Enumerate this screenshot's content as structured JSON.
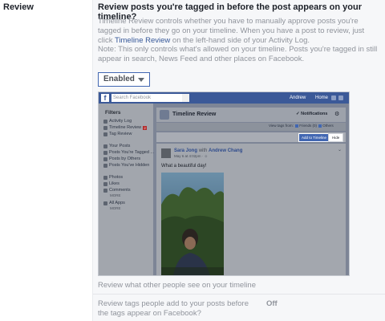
{
  "section": {
    "left_label": "Review",
    "heading": "Review posts you're tagged in before the post appears on your timeline?",
    "para1_a": "Timeline Review controls whether you have to manually approve posts you're tagged in before they go on your timeline. When you have a post to review, just click ",
    "para1_link": "Timeline Review",
    "para1_b": " on the left-hand side of your Activity Log.",
    "para2": "Note: This only controls what's allowed on your timeline. Posts you're tagged in still appear in search, News Feed and other places on Facebook.",
    "select_value": "Enabled"
  },
  "screenshot": {
    "fb_logo": "f",
    "search_placeholder": "Search Facebook",
    "user": "Andrew",
    "home": "Home",
    "sidebar_title": "Filters",
    "sidebar_items": [
      {
        "label": "Activity Log"
      },
      {
        "label": "Timeline Review",
        "badge": "2"
      },
      {
        "label": "Tag Review"
      },
      {
        "label": "Your Posts"
      },
      {
        "label": "Posts You're Tagged ..."
      },
      {
        "label": "Posts by Others"
      },
      {
        "label": "Posts You've Hidden"
      },
      {
        "label": "Photos"
      },
      {
        "label": "Likes"
      },
      {
        "label": "Comments"
      },
      {
        "label": "All Apps"
      }
    ],
    "sidebar_more_1": "MORE",
    "sidebar_more_2": "MORE",
    "page_title": "Timeline Review",
    "notifications": "Notifications",
    "view_tags_from": "View tags from:",
    "friends_filter": "Friends (0)",
    "others_filter": "Others",
    "add_button": "Add to Timeline",
    "hide_button": "Hide",
    "post_author": "Sara Jong",
    "post_with": "with",
    "post_tagged": "Andrew Chang",
    "post_meta": "May 6 at 4:02pm · ",
    "post_text": "What a beautiful day!"
  },
  "settings": [
    {
      "label": "Review what other people see on your timeline",
      "value": ""
    },
    {
      "label": "Review tags people add to your posts before the tags appear on Facebook?",
      "value": "Off"
    }
  ]
}
